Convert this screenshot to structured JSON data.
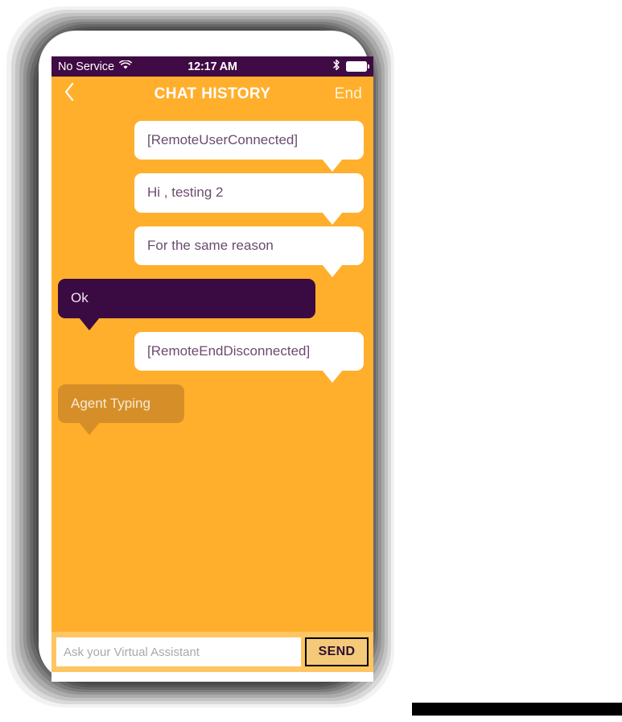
{
  "device": {
    "frame_color": "#4a4a4a",
    "body_color": "#ffffff"
  },
  "theme": {
    "accent_orange": "#ffaf2c",
    "status_purple": "#400a44",
    "bubble_dark": "#3a0a42",
    "bubble_light": "#ffffff",
    "bubble_typing": "#d68f28",
    "composer_bg": "#ffc563",
    "send_fill": "#f5c97a",
    "text_muted_purple": "#6b4c6e"
  },
  "status_bar": {
    "carrier": "No Service",
    "wifi_icon": "wifi-icon",
    "time": "12:17 AM",
    "bluetooth_icon": "bluetooth-icon",
    "battery_icon": "battery-icon"
  },
  "nav_bar": {
    "back_icon": "chevron-left-icon",
    "title": "CHAT HISTORY",
    "end_label": "End"
  },
  "messages": [
    {
      "id": 1,
      "text": "[RemoteUserConnected]",
      "side": "incoming"
    },
    {
      "id": 2,
      "text": "Hi , testing 2",
      "side": "incoming"
    },
    {
      "id": 3,
      "text": "For the same reason",
      "side": "incoming"
    },
    {
      "id": 4,
      "text": "Ok",
      "side": "outgoing"
    },
    {
      "id": 5,
      "text": "[RemoteEndDisconnected]",
      "side": "incoming"
    },
    {
      "id": 6,
      "text": "Agent Typing",
      "side": "typing"
    }
  ],
  "composer": {
    "input_value": "",
    "input_placeholder": "Ask your Virtual Assistant",
    "send_label": "SEND"
  }
}
